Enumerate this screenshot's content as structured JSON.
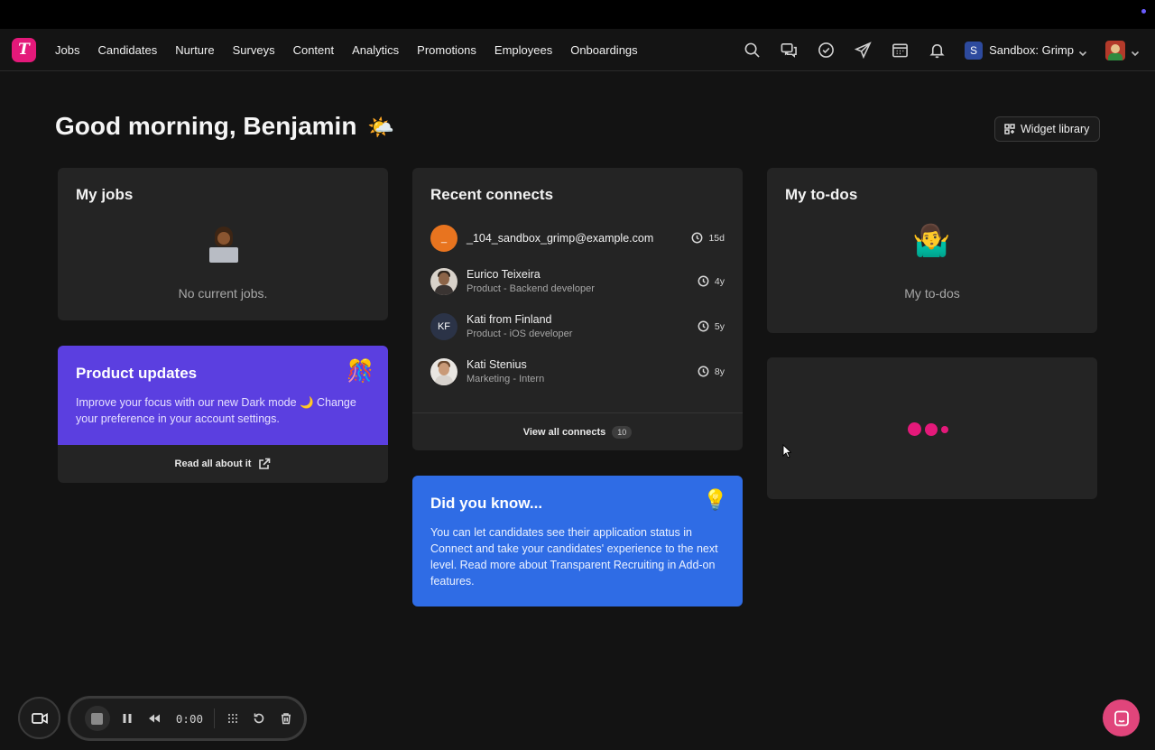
{
  "nav": {
    "logo_letter": "T",
    "items": [
      "Jobs",
      "Candidates",
      "Nurture",
      "Surveys",
      "Content",
      "Analytics",
      "Promotions",
      "Employees",
      "Onboardings"
    ],
    "icons": [
      "search-icon",
      "messages-icon",
      "check-circle-icon",
      "send-icon",
      "calendar-icon",
      "bell-icon"
    ],
    "org_badge": "S",
    "org_name": "Sandbox: Grimp"
  },
  "greeting": {
    "text": "Good morning, Benjamin",
    "emoji": "🌤️"
  },
  "widget_library": {
    "label": "Widget library"
  },
  "my_jobs": {
    "title": "My jobs",
    "empty_text": "No current jobs."
  },
  "product_updates": {
    "title": "Product updates",
    "emoji": "🎊",
    "body": "Improve your focus with our new Dark mode 🌙 Change your preference in your account settings.",
    "link_label": "Read all about it"
  },
  "recent_connects": {
    "title": "Recent connects",
    "items": [
      {
        "name": "_104_sandbox_grimp@example.com",
        "subtitle": "",
        "initials": "_",
        "avatar_color": "#e8741f",
        "time": "15d"
      },
      {
        "name": "Eurico Teixeira",
        "subtitle": "Product - Backend developer",
        "initials": "",
        "avatar_color": "",
        "time": "4y"
      },
      {
        "name": "Kati from Finland",
        "subtitle": "Product - iOS developer",
        "initials": "KF",
        "avatar_color": "#2b3347",
        "time": "5y"
      },
      {
        "name": "Kati Stenius",
        "subtitle": "Marketing - Intern",
        "initials": "",
        "avatar_color": "",
        "time": "8y"
      }
    ],
    "view_all_label": "View all connects",
    "view_all_count": "10"
  },
  "did_you_know": {
    "title": "Did you know...",
    "emoji": "💡",
    "body": "You can let candidates see their application status in Connect and take your candidates' experience to the next level. Read more about Transparent Recruiting in Add-on features."
  },
  "my_todos": {
    "title": "My to-dos",
    "emoji": "🤷‍♂️",
    "empty_text": "My to-dos"
  },
  "recorder": {
    "time": "0:00"
  },
  "colors": {
    "brand": "#e4197a",
    "product_updates_bg": "#5b3fe0",
    "did_you_know_bg": "#2f6ce5",
    "chat_bubble": "#e0457b"
  }
}
